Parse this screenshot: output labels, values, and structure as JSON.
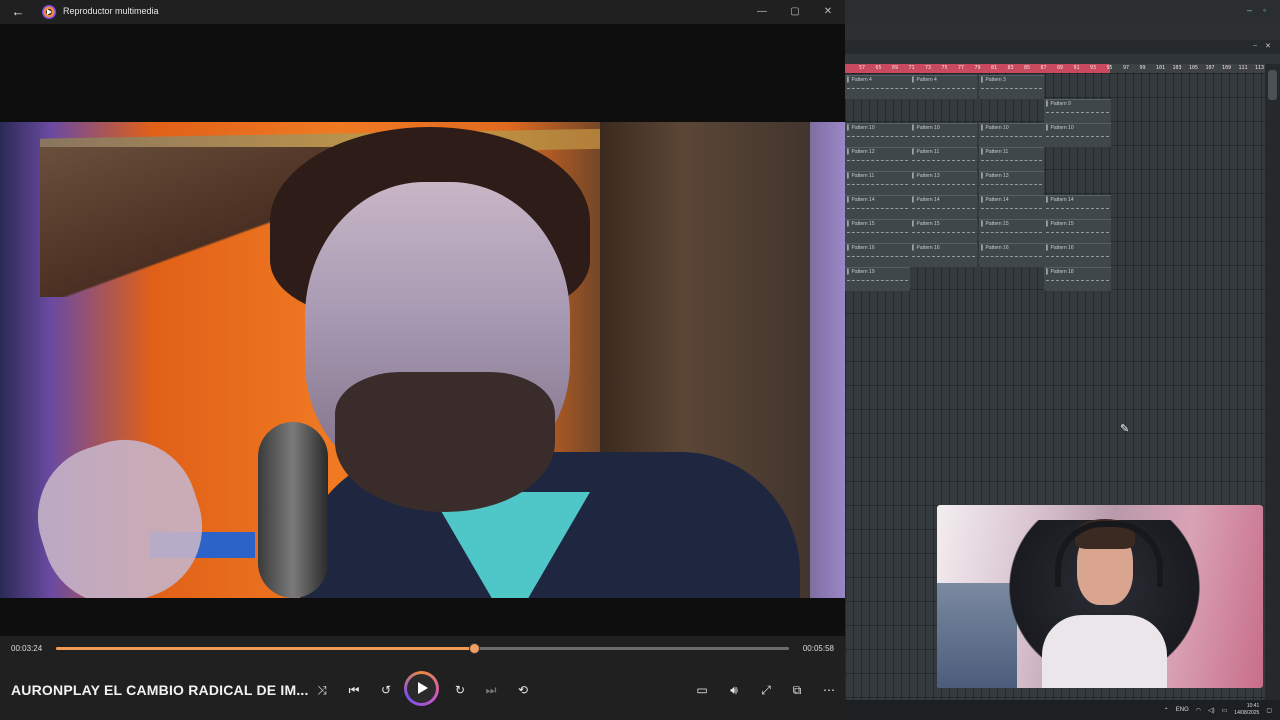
{
  "player": {
    "window_title": "Reproductor multimedia",
    "time_current": "00:03:24",
    "time_total": "00:05:58",
    "progress": 0.57,
    "media_title": "AURONPLAY EL CAMBIO RADICAL DE IM...",
    "accent": "#f09a55",
    "play_gradient": [
      "#f08a3c",
      "#7a4ff0"
    ]
  },
  "daw": {
    "ruler_ticks": [
      "57",
      "65",
      "69",
      "71",
      "73",
      "75",
      "77",
      "79",
      "81",
      "83",
      "85",
      "87",
      "89",
      "91",
      "93",
      "95",
      "97",
      "99",
      "101",
      "103",
      "105",
      "107",
      "109",
      "111",
      "113"
    ],
    "clips": [
      {
        "label": "Pattern 4"
      },
      {
        "label": "Pattern 4"
      },
      {
        "label": "Pattern 3"
      },
      {
        "label": "Pattern 9"
      },
      {
        "label": "Pattern 10"
      },
      {
        "label": "Pattern 10"
      },
      {
        "label": "Pattern 10"
      },
      {
        "label": "Pattern 10"
      },
      {
        "label": "Pattern 12"
      },
      {
        "label": "Pattern 11"
      },
      {
        "label": "Pattern 11"
      },
      {
        "label": "Pattern 11"
      },
      {
        "label": "Pattern 13"
      },
      {
        "label": "Pattern 13"
      },
      {
        "label": "Pattern 14"
      },
      {
        "label": "Pattern 14"
      },
      {
        "label": "Pattern 14"
      },
      {
        "label": "Pattern 14"
      },
      {
        "label": "Pattern 15"
      },
      {
        "label": "Pattern 15"
      },
      {
        "label": "Pattern 15"
      },
      {
        "label": "Pattern 15"
      },
      {
        "label": "Pattern 16"
      },
      {
        "label": "Pattern 16"
      },
      {
        "label": "Pattern 16"
      },
      {
        "label": "Pattern 16"
      },
      {
        "label": "Pattern 19"
      },
      {
        "label": "Pattern 18"
      }
    ]
  },
  "taskbar": {
    "lang": "ENG",
    "time": "10:41",
    "date": "14/08/2025"
  }
}
